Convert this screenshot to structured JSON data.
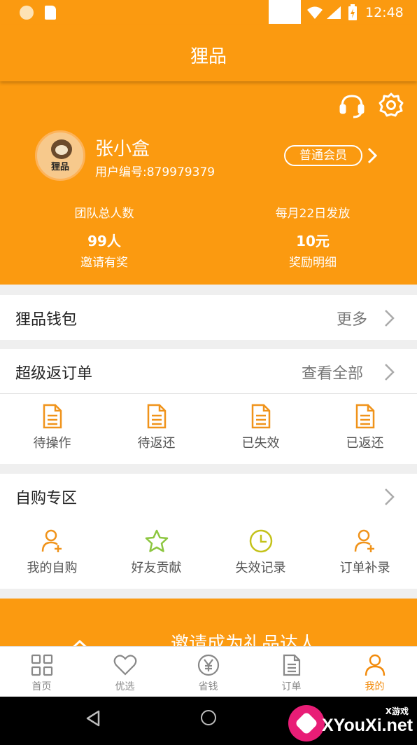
{
  "status_bar": {
    "time": "12:48"
  },
  "header": {
    "title": "狸品"
  },
  "profile": {
    "avatar_text": "狸品",
    "name": "张小盒",
    "user_id": "用户编号:879979379",
    "member_level": "普通会员",
    "stats": [
      {
        "label": "团队总人数",
        "value": "99人",
        "sub": "邀请有奖"
      },
      {
        "label": "每月22日发放",
        "value": "10元",
        "sub": "奖励明细"
      }
    ]
  },
  "wallet": {
    "title": "狸品钱包",
    "more": "更多"
  },
  "orders": {
    "title": "超级返订单",
    "more": "查看全部",
    "items": [
      {
        "label": "待操作",
        "icon": "document-icon"
      },
      {
        "label": "待返还",
        "icon": "document-icon"
      },
      {
        "label": "已失效",
        "icon": "document-icon"
      },
      {
        "label": "已返还",
        "icon": "document-icon"
      }
    ]
  },
  "self_buy": {
    "title": "自购专区",
    "items": [
      {
        "label": "我的自购",
        "icon": "user-add-icon"
      },
      {
        "label": "好友贡献",
        "icon": "star-icon"
      },
      {
        "label": "失效记录",
        "icon": "clock-icon"
      },
      {
        "label": "订单补录",
        "icon": "user-add-icon"
      }
    ]
  },
  "banner": {
    "text": "邀请成为礼品达人"
  },
  "tabbar": {
    "tabs": [
      {
        "label": "首页",
        "icon": "grid-icon"
      },
      {
        "label": "优选",
        "icon": "heart-icon"
      },
      {
        "label": "省钱",
        "icon": "yen-icon"
      },
      {
        "label": "订单",
        "icon": "document-icon"
      },
      {
        "label": "我的",
        "icon": "person-icon",
        "active": true
      }
    ]
  },
  "watermark": {
    "site": "XYouXi.net",
    "tag": "X游戏"
  },
  "colors": {
    "accent": "#fb9a10",
    "active_tab": "#f28a0a",
    "star_green": "#8cc63f",
    "clock_yellow": "#c4c21a"
  }
}
